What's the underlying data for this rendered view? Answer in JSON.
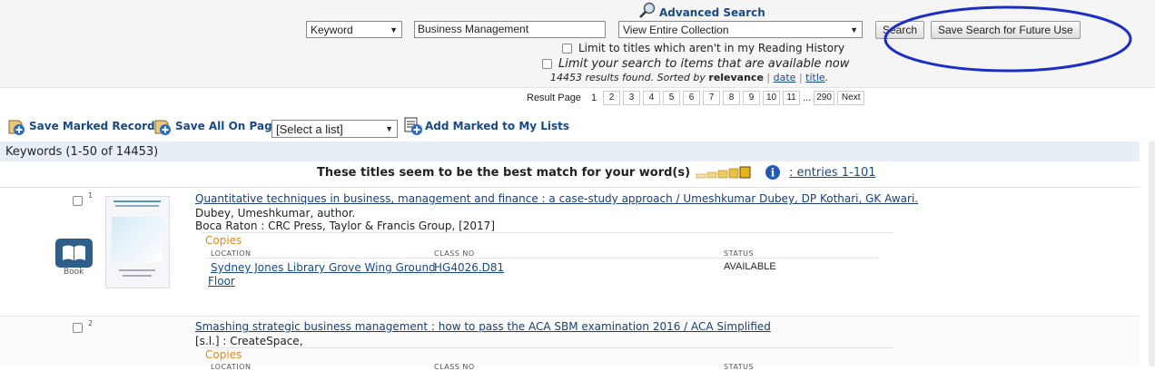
{
  "search": {
    "field_select": "Keyword",
    "query_value": "Business Management",
    "collection_select": "View Entire Collection",
    "advanced_label": "Advanced Search",
    "search_label": "Search",
    "save_label": "Save Search for Future Use",
    "limit_history_label": "Limit to titles which aren't in my Reading History",
    "limit_available_label": "Limit your search to items that are available now",
    "results_found": "14453 results found. Sorted by",
    "sort_current": "relevance",
    "sort_sep1": "|",
    "sort_date": "date",
    "sort_sep2": "|",
    "sort_title": "title",
    "sort_end": "."
  },
  "pagination": {
    "label": "Result Page",
    "current": "1",
    "pages": [
      "2",
      "3",
      "4",
      "5",
      "6",
      "7",
      "8",
      "9",
      "10",
      "11"
    ],
    "ellipsis": "...",
    "last": "290",
    "next": "Next"
  },
  "toolbar": {
    "save_marked": "Save Marked Records",
    "save_all": "Save All On Page",
    "list_select": "[Select a list]",
    "add_marked": "Add Marked to My Lists"
  },
  "results_header": "Keywords (1-50 of 14453)",
  "relevance": {
    "text": "These titles seem to be the best match for your word(s)",
    "entries_link": ":  entries 1-101"
  },
  "records": [
    {
      "num": "1",
      "title": "Quantitative techniques in business, management and finance : a case-study approach / Umeshkumar Dubey, DP Kothari, GK Awari.",
      "author": "Dubey, Umeshkumar, author.",
      "publisher": "Boca Raton : CRC Press, Taylor & Francis Group, [2017]",
      "format": "Book",
      "copies_label": "Copies",
      "col_location": "LOCATION",
      "col_class": "CLASS NO",
      "col_status": "STATUS",
      "location_line1": "Sydney Jones Library Grove Wing Ground",
      "location_line2": "Floor",
      "class_no": "HG4026.D81",
      "status": "AVAILABLE"
    },
    {
      "num": "2",
      "title": "Smashing strategic business management : how to pass the ACA SBM examination 2016 / ACA Simplified",
      "publisher": "[s.l.] : CreateSpace,",
      "copies_label": "Copies",
      "col_location": "LOCATION",
      "col_class": "CLASS NO",
      "col_status": "STATUS"
    }
  ]
}
